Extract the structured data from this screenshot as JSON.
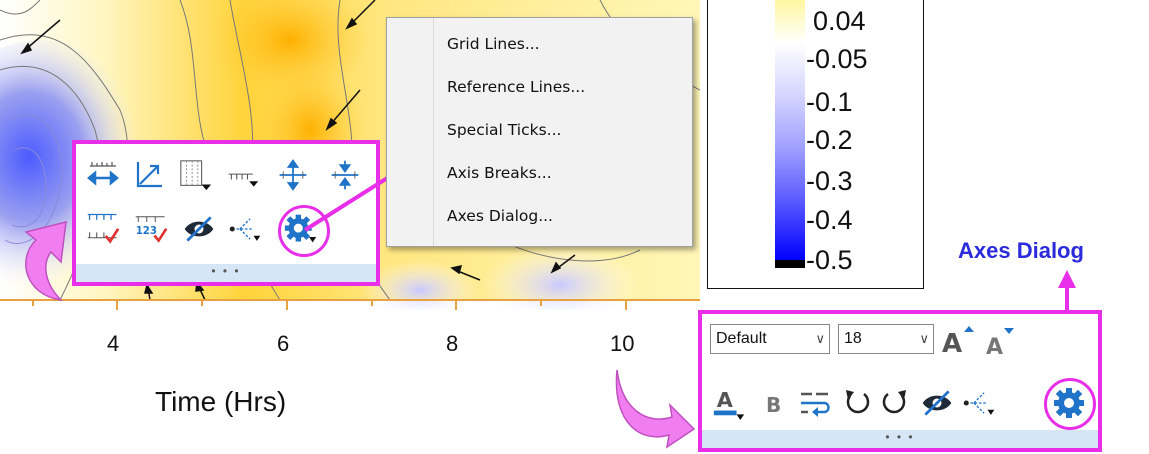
{
  "plot": {
    "x_ticks": [
      "4",
      "6",
      "8",
      "10"
    ],
    "x_axis_title": "Time (Hrs)"
  },
  "legend": {
    "labels": [
      "0.04",
      "-0.05",
      "-0.1",
      "-0.2",
      "-0.3",
      "-0.4",
      "-0.5"
    ],
    "colors": [
      "#fff9a8",
      "#ffffff",
      "#d8d8ff",
      "#b0b0ff",
      "#8080ff",
      "#4c4cff",
      "#0000ff"
    ]
  },
  "axis_toolbar": {
    "row1_icons": [
      "axis-scale-icon",
      "axis-xy-icon",
      "grid-lines-icon",
      "tick-style-icon",
      "axis-expand-icon",
      "axis-shrink-icon"
    ],
    "row2_icons": [
      "tick-labels-show-icon",
      "tick-numbers-icon",
      "hide-icon",
      "select-more-icon",
      "settings-gear-icon"
    ],
    "footer": "• • •"
  },
  "context_menu": {
    "items": [
      "Grid Lines...",
      "Reference Lines...",
      "Special Ticks...",
      "Axis Breaks...",
      "Axes Dialog..."
    ]
  },
  "text_toolbar": {
    "font_value": "Default",
    "size_value": "18",
    "footer": "• • •"
  },
  "callout": {
    "label": "Axes Dialog"
  },
  "colors": {
    "highlight": "#e82ee8",
    "axis_orange": "#e8a040",
    "icon_blue": "#1f73c8"
  }
}
